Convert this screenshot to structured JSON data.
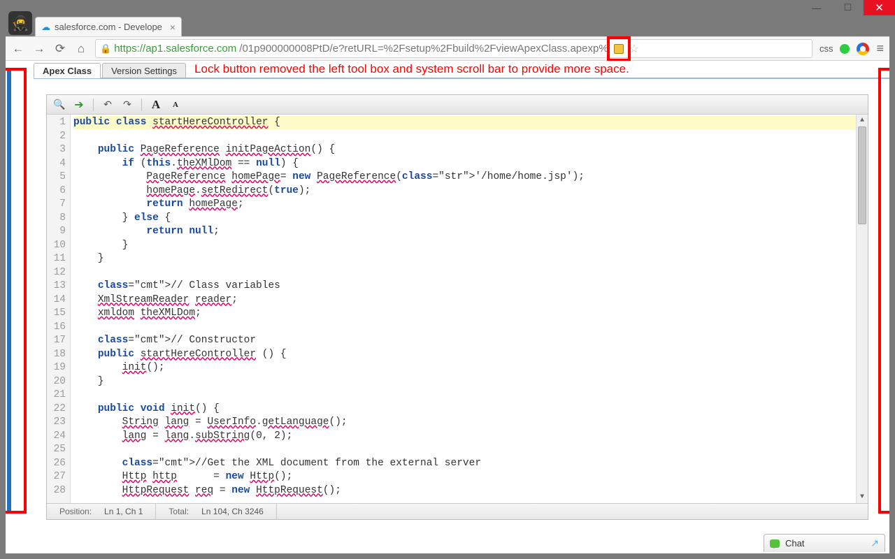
{
  "window": {
    "minimize": "—",
    "maximize": "☐",
    "close": "✕"
  },
  "browser": {
    "tab_title": "salesforce.com - Develope",
    "url_scheme_host": "https://ap1.salesforce.com",
    "url_path": "/01p900000008PtD/e?retURL=%2Fsetup%2Fbuild%2FviewApexClass.apexp%",
    "ext_css_label": "css"
  },
  "page": {
    "tabs": [
      "Apex Class",
      "Version Settings"
    ],
    "annotation": "Lock button removed the left tool box and system scroll bar to provide more space."
  },
  "editor": {
    "status": {
      "position_label": "Position:",
      "position_value": "Ln 1, Ch 1",
      "total_label": "Total:",
      "total_value": "Ln 104, Ch 3246"
    },
    "line_numbers": [
      "1",
      "2",
      "3",
      "4",
      "5",
      "6",
      "7",
      "8",
      "9",
      "10",
      "11",
      "12",
      "13",
      "14",
      "15",
      "16",
      "17",
      "18",
      "19",
      "20",
      "21",
      "22",
      "23",
      "24",
      "25",
      "26",
      "27",
      "28"
    ],
    "code_lines": [
      "public class startHereController {",
      "",
      "    public PageReference initPageAction() {",
      "        if (this.theXMlDom == null) {",
      "            PageReference homePage= new PageReference('/home/home.jsp');",
      "            homePage.setRedirect(true);",
      "            return homePage;",
      "        } else {",
      "            return null;",
      "        }",
      "    }",
      "",
      "    // Class variables",
      "    XmlStreamReader reader;",
      "    xmldom theXMLDom;",
      "",
      "    // Constructor",
      "    public startHereController () {",
      "        init();",
      "    }",
      "",
      "    public void init() {",
      "        String lang = UserInfo.getLanguage();",
      "        lang = lang.subString(0, 2);",
      "",
      "        //Get the XML document from the external server",
      "        Http http      = new Http();",
      "        HttpRequest req = new HttpRequest();"
    ]
  },
  "chat": {
    "label": "Chat"
  }
}
